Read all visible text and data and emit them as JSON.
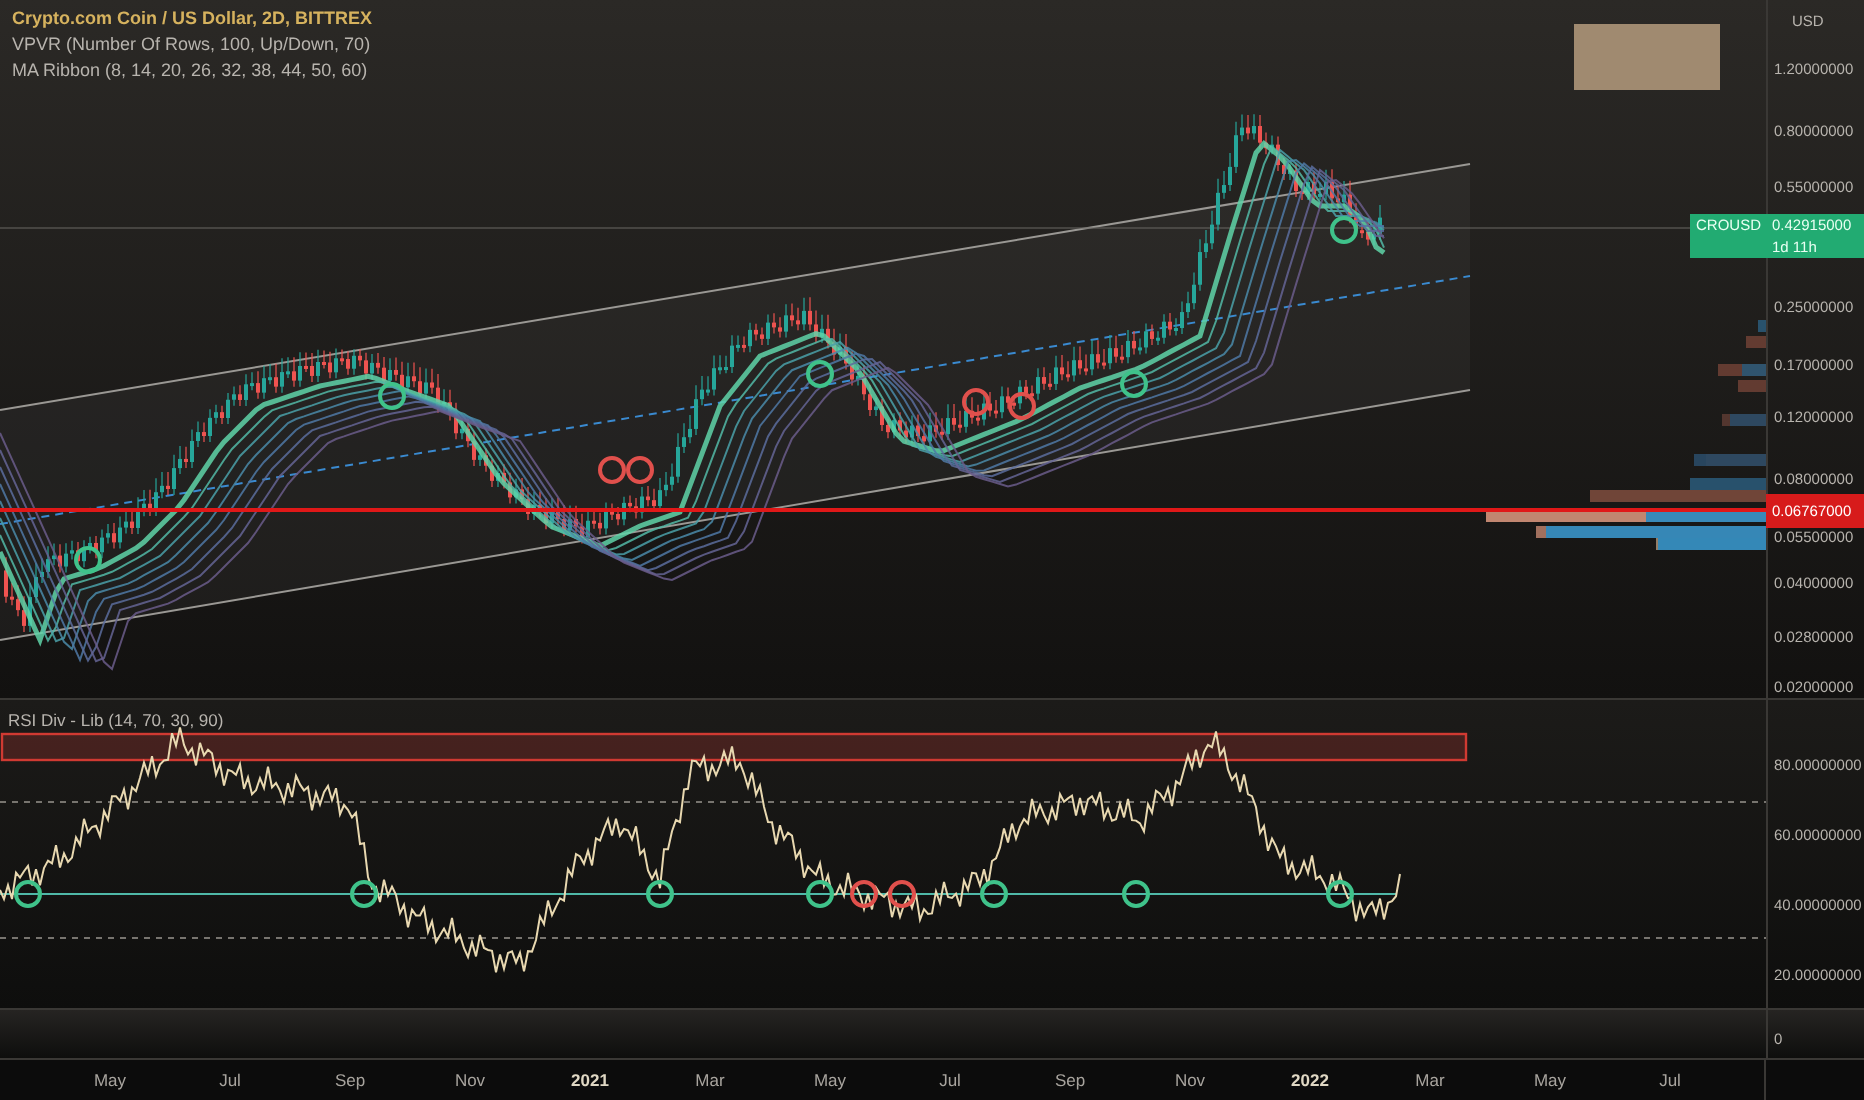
{
  "legend": {
    "title": "Crypto.com Coin / US Dollar, 2D, BITTREX",
    "indicators": [
      "VPVR (Number Of Rows, 100, Up/Down, 70)",
      "MA Ribbon (8, 14, 20, 26, 32, 38, 44, 50, 60)"
    ]
  },
  "price_axis": {
    "currency": "USD",
    "ticks": [
      "1.20000000",
      "0.80000000",
      "0.55000000",
      "0.25000000",
      "0.17000000",
      "0.12000000",
      "0.08000000",
      "0.05500000",
      "0.04000000",
      "0.02800000",
      "0.02000000"
    ]
  },
  "symbol_tag": {
    "symbol": "CROUSD",
    "price": "0.42915000",
    "countdown": "1d 11h"
  },
  "line_tag": {
    "price": "0.06767000"
  },
  "rsi_pane": {
    "title": "RSI Div - Lib (14, 70, 30, 90)",
    "ticks": [
      "80.00000000",
      "60.00000000",
      "40.00000000",
      "20.00000000"
    ]
  },
  "volume_pane": {
    "tick": "0"
  },
  "time_axis": {
    "labels": [
      {
        "text": "May",
        "kind": "month"
      },
      {
        "text": "Jul",
        "kind": "month"
      },
      {
        "text": "Sep",
        "kind": "month"
      },
      {
        "text": "Nov",
        "kind": "month"
      },
      {
        "text": "2021",
        "kind": "year"
      },
      {
        "text": "Mar",
        "kind": "month"
      },
      {
        "text": "May",
        "kind": "month"
      },
      {
        "text": "Jul",
        "kind": "month"
      },
      {
        "text": "Sep",
        "kind": "month"
      },
      {
        "text": "Nov",
        "kind": "month"
      },
      {
        "text": "2022",
        "kind": "year"
      },
      {
        "text": "Mar",
        "kind": "month"
      },
      {
        "text": "May",
        "kind": "month"
      },
      {
        "text": "Jul",
        "kind": "month"
      }
    ]
  }
}
